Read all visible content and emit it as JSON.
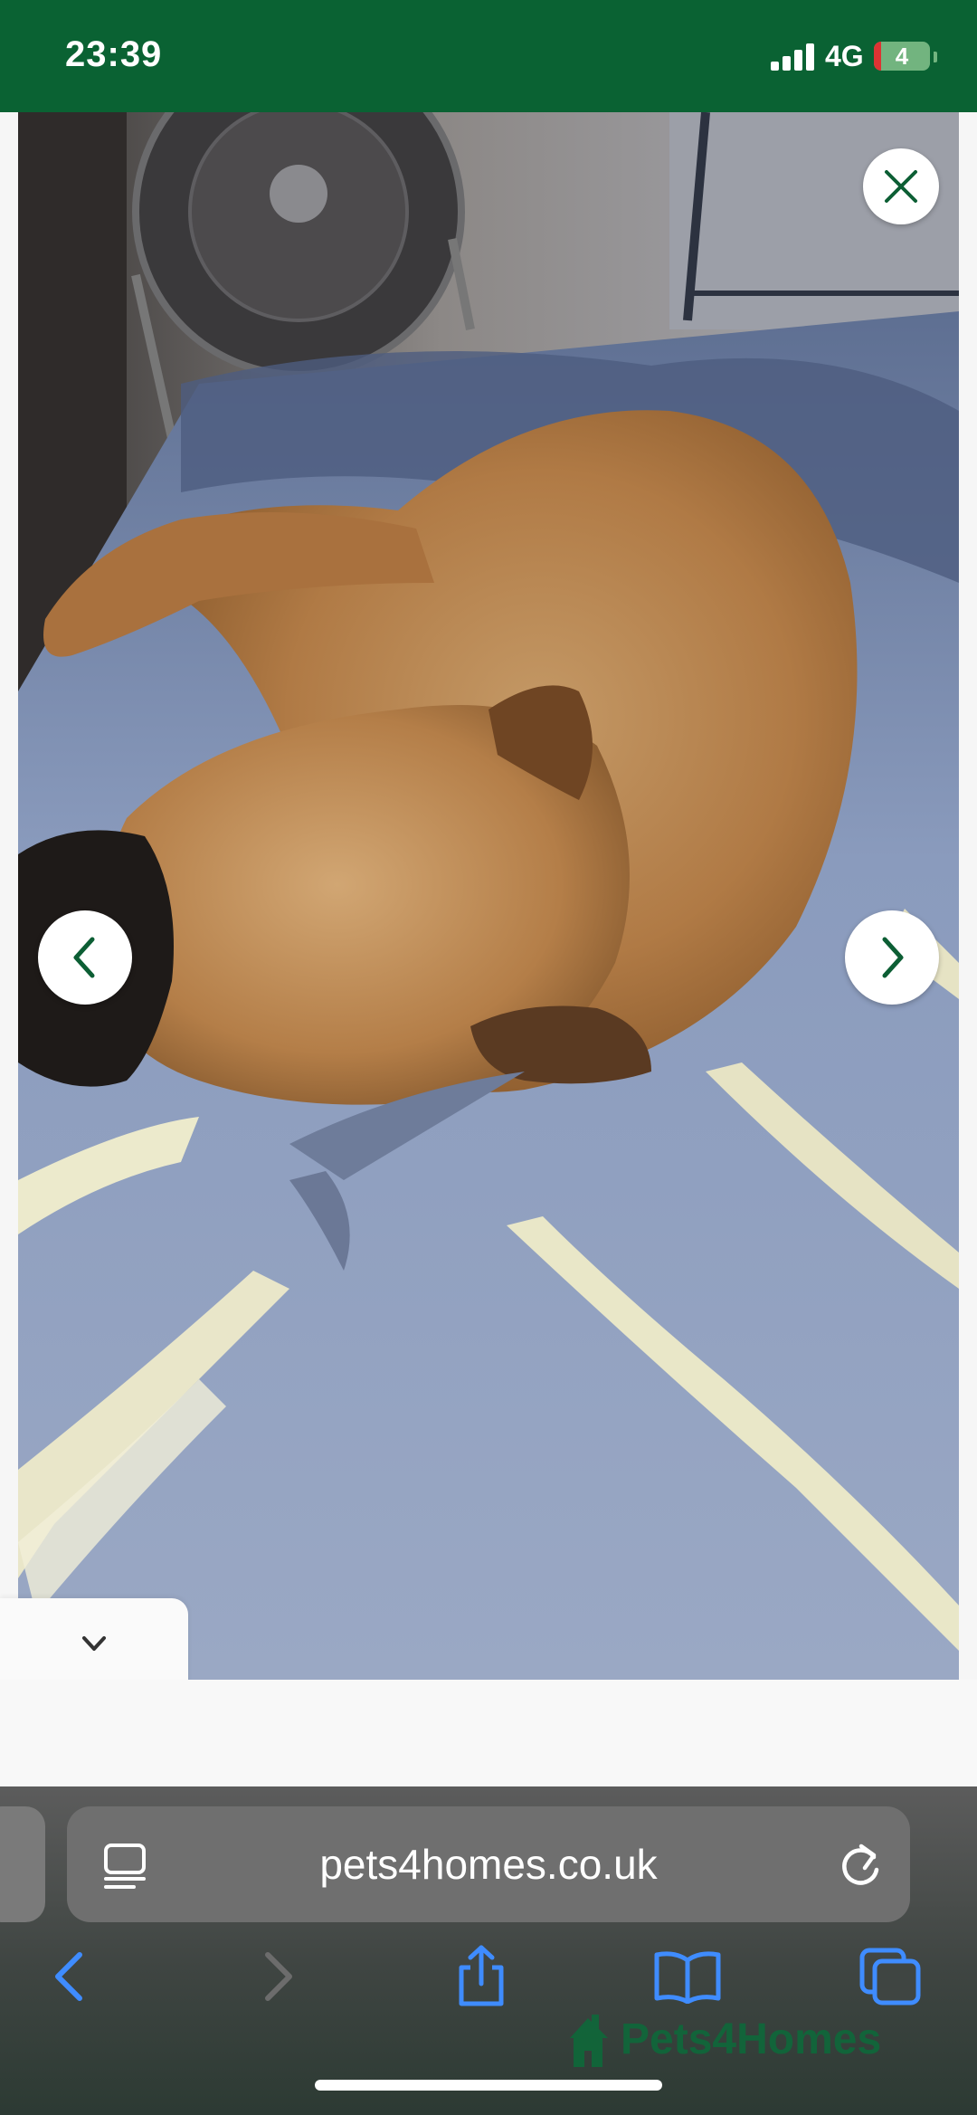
{
  "status_bar": {
    "time": "23:39",
    "network": "4G",
    "battery": "4",
    "background_color": "#0a6233"
  },
  "viewer": {
    "photo_alt": "dog sleeping on bed",
    "close_icon": "close-icon",
    "prev_icon": "chevron-left-icon",
    "next_icon": "chevron-right-icon",
    "collapse_icon": "chevron-down-icon",
    "collapse_label": "v",
    "accent_color": "#0c5e34"
  },
  "browser": {
    "url": "pets4homes.co.uk",
    "reader_icon": "reader-mode-icon",
    "reload_icon": "reload-icon",
    "toolbar": [
      "back-icon",
      "forward-icon",
      "share-icon",
      "bookmarks-icon",
      "tabs-icon"
    ],
    "accent_color": "#3f8cff"
  },
  "brand": {
    "name": "Pets4Homes",
    "color": "#0c6b3a"
  }
}
